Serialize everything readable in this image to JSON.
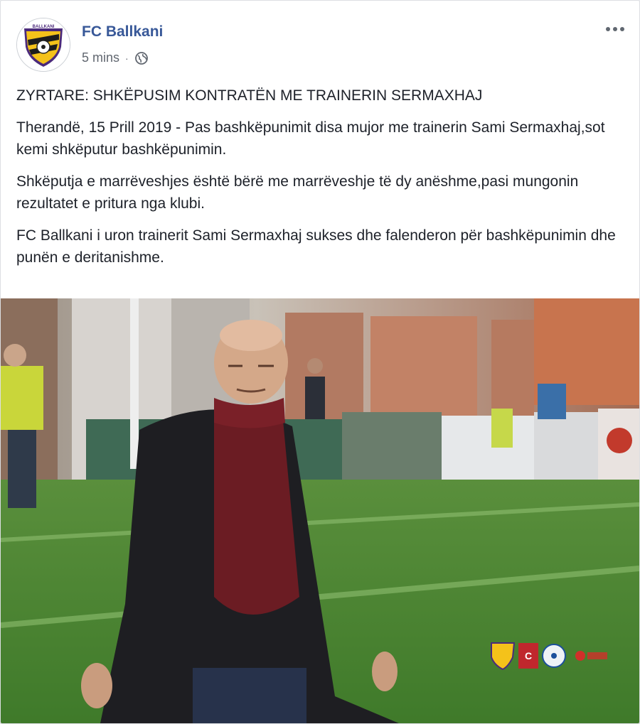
{
  "post": {
    "page_name": "FC Ballkani",
    "timestamp": "5 mins",
    "separator": "·",
    "privacy_icon": "globe-icon",
    "more_icon": "more-dots-icon"
  },
  "body": {
    "paragraphs": [
      "ZYRTARE: SHKËPUSIM KONTRATËN ME TRAINERIN SERMAXHAJ",
      "Therandë, 15 Prill 2019 - Pas bashkëpunimit disa mujor me trainerin Sami Sermaxhaj,sot kemi shkëputur bashkëpunimin.",
      "Shkëputja e marrëveshjes është bërë me marrëveshje të dy anëshme,pasi mungonin rezultatet e pritura nga klubi.",
      "FC Ballkani i uron trainerit Sami Sermaxhaj sukses dhe falenderon për bashkëpunimin dhe punën e deritanishme."
    ]
  },
  "colors": {
    "link": "#385898",
    "text": "#1d2129",
    "meta": "#616770",
    "club_yellow": "#f4c21a",
    "club_purple": "#4b2a7b"
  }
}
